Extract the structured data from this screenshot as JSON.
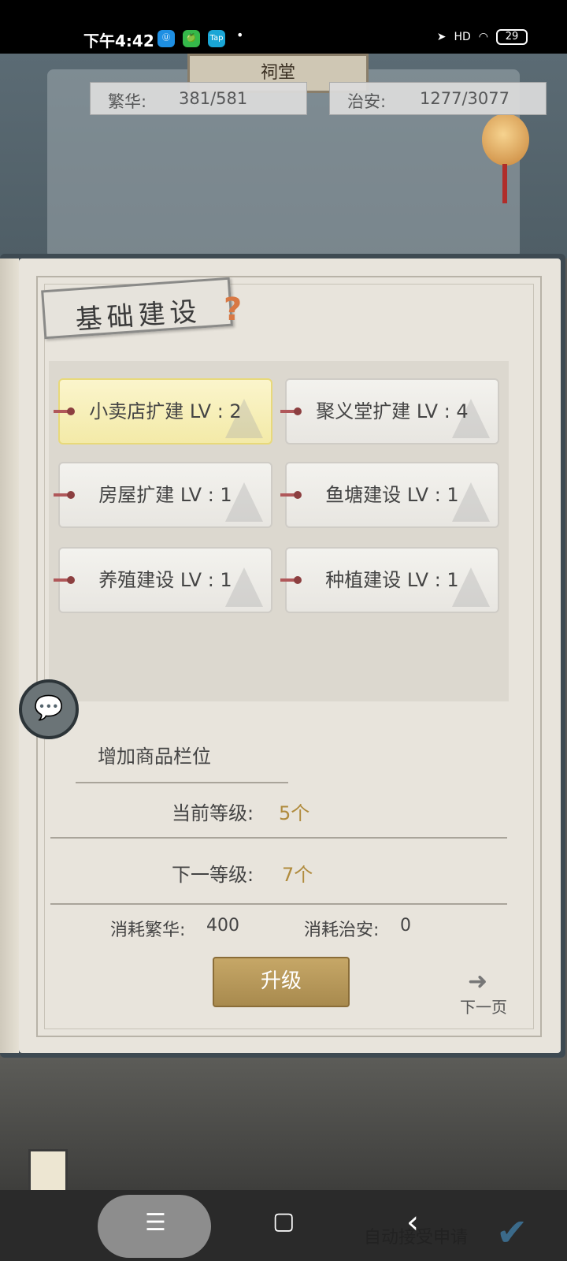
{
  "status_bar": {
    "time": "下午4:42",
    "apps": [
      "Ⓤ",
      "🍏",
      "Tap"
    ],
    "dot": "•",
    "signal": "HD",
    "battery": "29"
  },
  "header": {
    "plaque": "祠堂",
    "prosperity_label": "繁华:",
    "prosperity_value": "381/581",
    "security_label": "治安:",
    "security_value": "1277/3077"
  },
  "panel": {
    "title": "基础建设",
    "help": "?",
    "cards": [
      {
        "label": "小卖店扩建 LV : 2"
      },
      {
        "label": "聚义堂扩建 LV : 4"
      },
      {
        "label": "房屋扩建 LV : 1"
      },
      {
        "label": "鱼塘建设 LV : 1"
      },
      {
        "label": "养殖建设 LV : 1"
      },
      {
        "label": "种植建设 LV : 1"
      }
    ],
    "selected_index": 0,
    "description": "增加商品栏位",
    "current_level_label": "当前等级:",
    "current_level_value": "5个",
    "next_level_label": "下一等级:",
    "next_level_value": "7个",
    "cost_prosperity_label": "消耗繁华:",
    "cost_prosperity_value": "400",
    "cost_security_label": "消耗治安:",
    "cost_security_value": "0",
    "upgrade_label": "升级",
    "next_page_label": "下一页"
  },
  "chat_icon": "💬",
  "footer": {
    "auto_accept": "自动接受申请",
    "check": "✔"
  },
  "nav": {
    "menu": "☰",
    "home": "▢",
    "back": "‹"
  }
}
